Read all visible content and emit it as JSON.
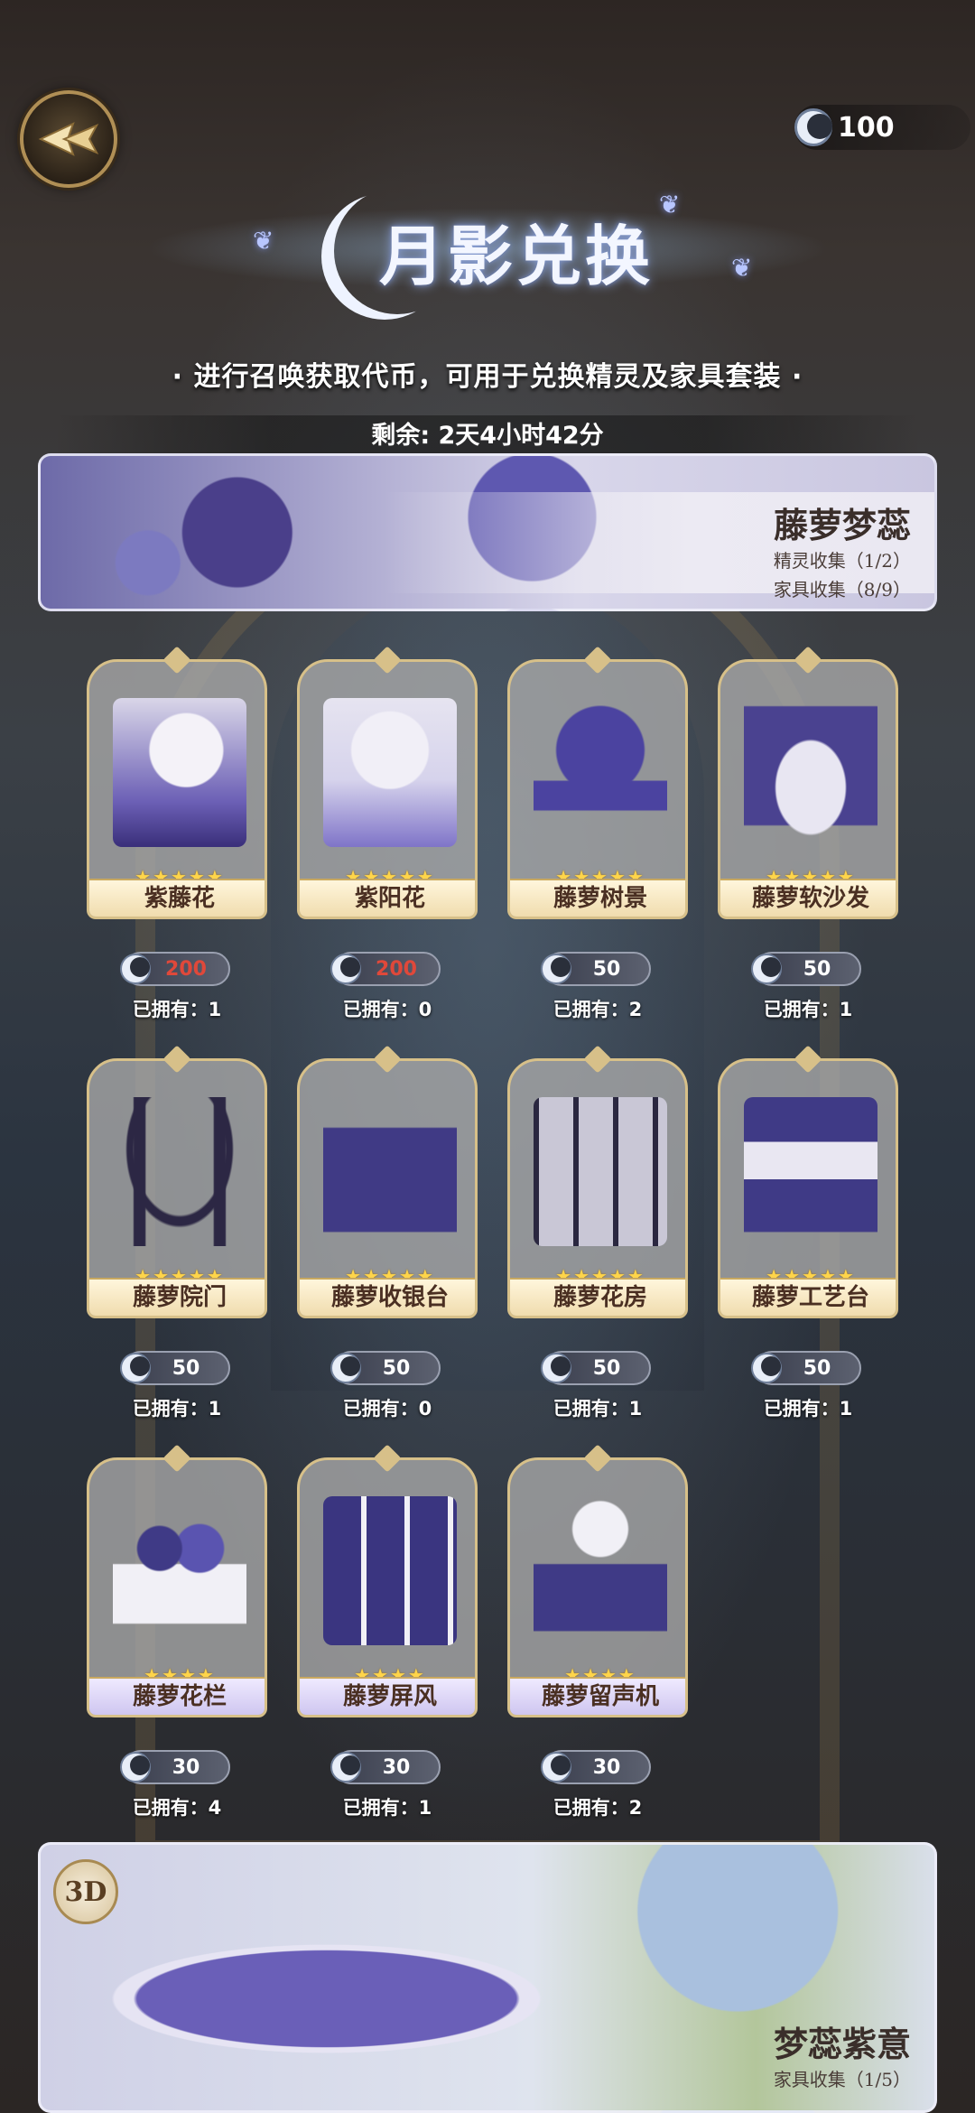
{
  "currency": {
    "icon": "moon-coin-icon",
    "amount": "100"
  },
  "title": "月影兑换",
  "subtitle": "· 进行召唤获取代币，可用于兑换精灵及家具套装 ·",
  "timer": "剩余: 2天4小时42分",
  "set_top": {
    "name": "藤萝梦蕊",
    "spirit_collect": "精灵收集（1/2）",
    "furniture_collect": "家具收集（8/9）"
  },
  "items": [
    {
      "name": "紫藤花",
      "stars": "★★★★★",
      "price": "200",
      "affordable": false,
      "owned": "已拥有：1"
    },
    {
      "name": "紫阳花",
      "stars": "★★★★★",
      "price": "200",
      "affordable": false,
      "owned": "已拥有：0"
    },
    {
      "name": "藤萝树景",
      "stars": "★★★★★",
      "price": "50",
      "affordable": true,
      "owned": "已拥有：2"
    },
    {
      "name": "藤萝软沙发",
      "stars": "★★★★★",
      "price": "50",
      "affordable": true,
      "owned": "已拥有：1"
    },
    {
      "name": "藤萝院门",
      "stars": "★★★★★",
      "price": "50",
      "affordable": true,
      "owned": "已拥有：1"
    },
    {
      "name": "藤萝收银台",
      "stars": "★★★★★",
      "price": "50",
      "affordable": true,
      "owned": "已拥有：0"
    },
    {
      "name": "藤萝花房",
      "stars": "★★★★★",
      "price": "50",
      "affordable": true,
      "owned": "已拥有：1"
    },
    {
      "name": "藤萝工艺台",
      "stars": "★★★★★",
      "price": "50",
      "affordable": true,
      "owned": "已拥有：1"
    },
    {
      "name": "藤萝花栏",
      "stars": "★★★★",
      "price": "30",
      "affordable": true,
      "owned": "已拥有：4"
    },
    {
      "name": "藤萝屏风",
      "stars": "★★★★",
      "price": "30",
      "affordable": true,
      "owned": "已拥有：1"
    },
    {
      "name": "藤萝留声机",
      "stars": "★★★★",
      "price": "30",
      "affordable": true,
      "owned": "已拥有：2"
    }
  ],
  "set_bottom": {
    "badge": "3D",
    "name": "梦蕊紫意",
    "furniture_collect": "家具收集（1/5）"
  },
  "colors": {
    "accent_gold": "#d7c089",
    "price_short": "#e0483a",
    "star": "#ffd54a",
    "theme_purple": "#5e58b0"
  }
}
